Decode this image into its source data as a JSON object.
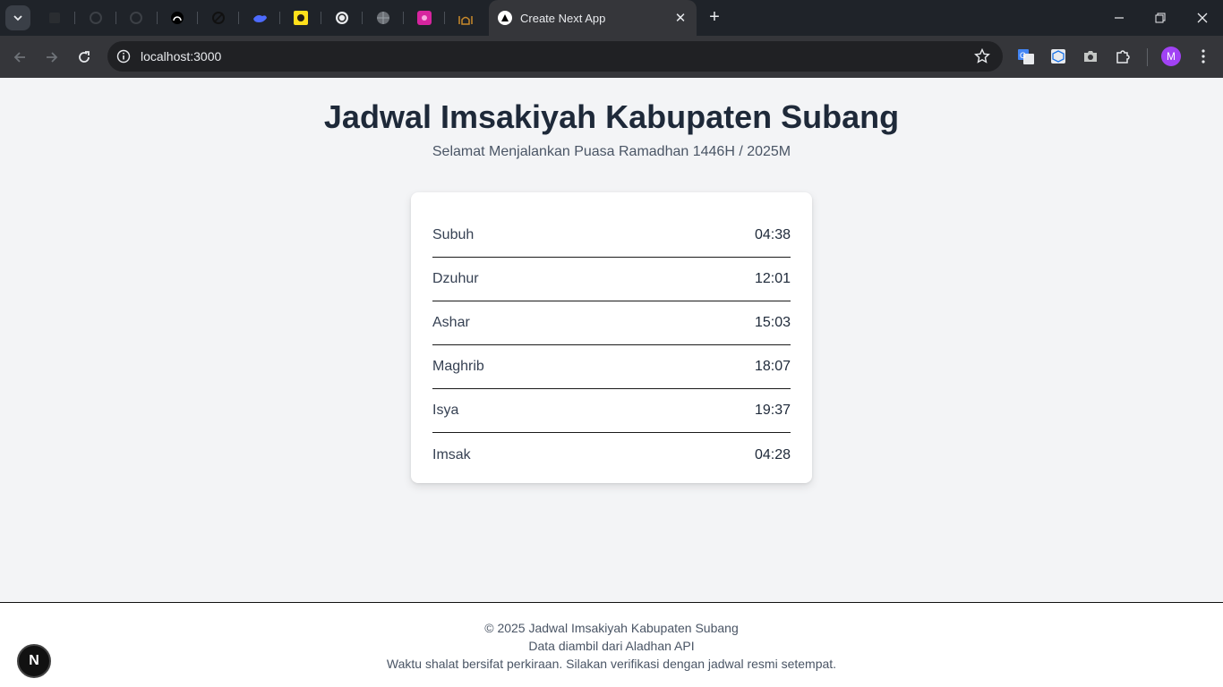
{
  "browser": {
    "active_tab_title": "Create Next App",
    "url": "localhost:3000",
    "profile_initial": "M"
  },
  "page": {
    "title": "Jadwal Imsakiyah Kabupaten Subang",
    "subtitle": "Selamat Menjalankan Puasa Ramadhan 1446H / 2025M",
    "schedule": [
      {
        "name": "Subuh",
        "time": "04:38"
      },
      {
        "name": "Dzuhur",
        "time": "12:01"
      },
      {
        "name": "Ashar",
        "time": "15:03"
      },
      {
        "name": "Maghrib",
        "time": "18:07"
      },
      {
        "name": "Isya",
        "time": "19:37"
      },
      {
        "name": "Imsak",
        "time": "04:28"
      }
    ],
    "footer": {
      "copyright": "© 2025 Jadwal Imsakiyah Kabupaten Subang",
      "source": "Data diambil dari Aladhan API",
      "disclaimer": "Waktu shalat bersifat perkiraan. Silakan verifikasi dengan jadwal resmi setempat."
    },
    "dev_badge": "N"
  }
}
